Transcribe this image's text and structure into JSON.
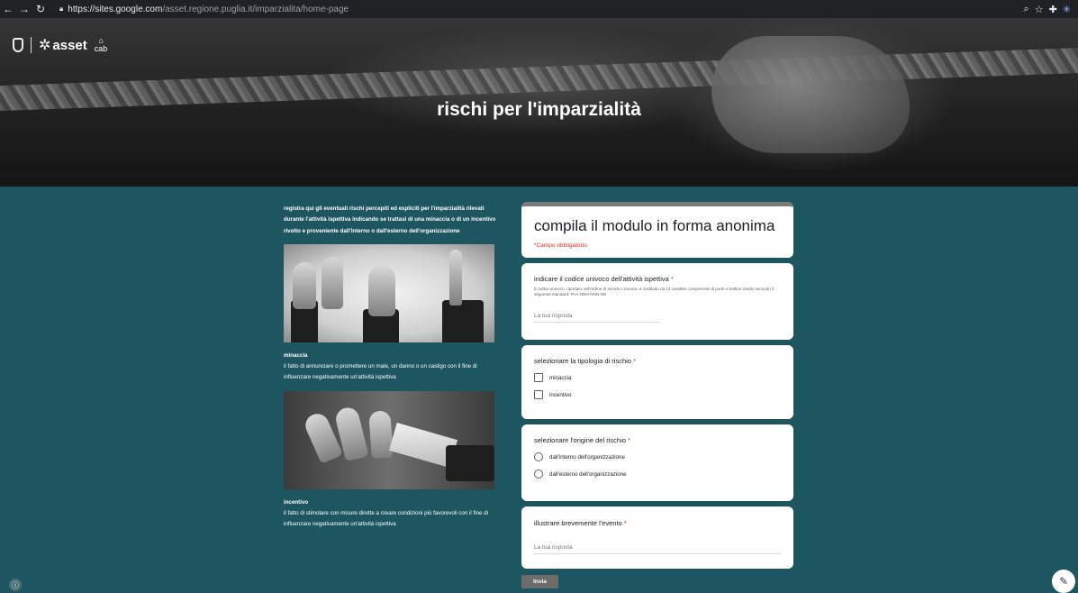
{
  "browser": {
    "url_host": "https://sites.google.com",
    "url_path": "/asset.regione.puglia.it/imparzialita/home-page",
    "icons": [
      "back-icon",
      "forward-icon",
      "reload-icon",
      "lock-icon",
      "zoom-icon",
      "star-icon",
      "extensions-icon",
      "profile-icon"
    ]
  },
  "header": {
    "logo_asset": "asset",
    "logo_cab": "cab",
    "title": "rischi per l'imparzialità"
  },
  "left": {
    "intro": "registra qui gli eventuali rischi percepiti ed espliciti per l'imparzialità rilevati durante l'attività ispettiva indicando se trattasi di una minaccia o di un incentivo rivolto e proveniente dall'interno o dall'esterno dell'organizzazione",
    "minaccia_title": "minaccia",
    "minaccia_text": "il fatto di annunciare o promettere un male, un danno o un castigo con il fine di influenzare negativamente un'attività ispettiva",
    "incentivo_title": "incentivo",
    "incentivo_text": "il fatto di stimolare con misure dirette a creare condizioni più favorevoli con il fine di influenzare negativamente un'attività ispettiva"
  },
  "form": {
    "title": "compila il modulo in forma anonima",
    "required_note": "*Campo obbligatorio",
    "q1": {
      "title": "indicare il codice univoco dell'attività ispettiva",
      "help": "il codice univoco, riportato nell'ordine di servizio ricevuto, è costituito da 14 caratteri comprensivi di punti e trattino medio secondo il seguente standard: PAA.NNN-NNN.NN",
      "placeholder": "La tua risposta"
    },
    "q2": {
      "title": "selezionare la tipologia di rischio",
      "options": [
        "minaccia",
        "incentivo"
      ]
    },
    "q3": {
      "title": "selezionare l'origine del rischio",
      "options": [
        "dall'interno dell'organizzazione",
        "dall'esterno dell'organizzazione"
      ]
    },
    "q4": {
      "title": "illustrare brevemente l'evento",
      "placeholder": "La tua risposta"
    },
    "required_mark": "*",
    "submit_label": "Invia"
  },
  "colors": {
    "page_bg": "#1d5560",
    "required": "#d93025",
    "header_accent": "#7b7b7b"
  }
}
